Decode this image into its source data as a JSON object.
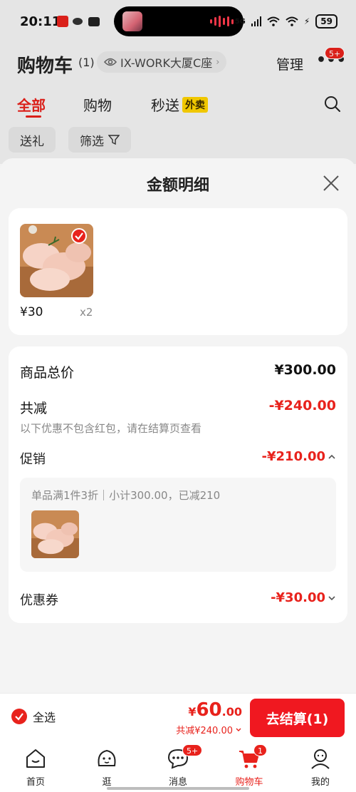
{
  "status_bar": {
    "time": "20:11",
    "network": "5G",
    "battery": "59"
  },
  "header": {
    "title": "购物车",
    "count": "(1)",
    "location": "IX-WORK大厦C座",
    "manage": "管理",
    "more_badge": "5+"
  },
  "tabs": [
    {
      "label": "全部"
    },
    {
      "label": "购物"
    },
    {
      "label": "秒送",
      "tag": "外卖"
    }
  ],
  "chips": {
    "gift": "送礼",
    "filter": "筛选"
  },
  "sheet": {
    "title": "金额明细",
    "product": {
      "price": "¥30",
      "qty": "x2"
    },
    "total_price": {
      "label": "商品总价",
      "value": "¥300.00"
    },
    "total_discount": {
      "label": "共减",
      "value": "-¥240.00",
      "note": "以下优惠不包含红包，请在结算页查看"
    },
    "promotion": {
      "label": "促销",
      "value": "-¥210.00",
      "detail": "单品满1件3折｜小计300.00，已减210"
    },
    "coupon": {
      "label": "优惠券",
      "value": "-¥30.00"
    }
  },
  "bottom_bar": {
    "select_all": "全选",
    "currency": "¥",
    "total_int": "60",
    "total_dec": ".00",
    "discount_note": "共减¥240.00",
    "checkout": "去结算(1)"
  },
  "tabbar": [
    {
      "label": "首页"
    },
    {
      "label": "逛"
    },
    {
      "label": "消息",
      "badge": "5+"
    },
    {
      "label": "购物车",
      "badge": "1"
    },
    {
      "label": "我的"
    }
  ],
  "colors": {
    "accent": "#e8221c",
    "checkout_bg": "#f01820",
    "tag_yellow": "#ffd400"
  }
}
